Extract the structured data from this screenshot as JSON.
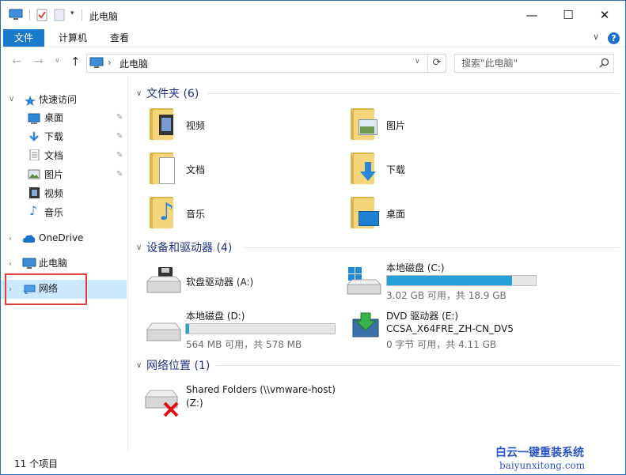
{
  "window": {
    "title": "此电脑",
    "controls": {
      "minimize": "—",
      "maximize": "☐",
      "close": "✕"
    }
  },
  "ribbon": {
    "tabs": [
      "文件",
      "计算机",
      "查看"
    ],
    "help": "?",
    "expand": "∨"
  },
  "address": {
    "path_root": "›",
    "path": "此电脑",
    "search_placeholder": "搜索\"此电脑\""
  },
  "nav": {
    "quick_access": "快速访问",
    "quick_items": [
      "桌面",
      "下载",
      "文档",
      "图片",
      "视频",
      "音乐"
    ],
    "onedrive": "OneDrive",
    "this_pc": "此电脑",
    "network": "网络"
  },
  "content": {
    "folders_header": "文件夹 (6)",
    "folders": [
      "视频",
      "图片",
      "文档",
      "下载",
      "音乐",
      "桌面"
    ],
    "devices_header": "设备和驱动器 (4)",
    "drives": [
      {
        "name": "软盘驱动器 (A:)",
        "sub": "",
        "fraction_used": null
      },
      {
        "name": "本地磁盘 (C:)",
        "sub": "3.02 GB 可用，共 18.9 GB",
        "fraction_used": 0.84
      },
      {
        "name": "本地磁盘 (D:)",
        "sub": "564 MB 可用，共 578 MB",
        "fraction_used": 0.02
      },
      {
        "name": "DVD 驱动器 (E:)",
        "label2": "CCSA_X64FRE_ZH-CN_DV5",
        "sub": "0 字节 可用，共 4.11 GB",
        "fraction_used": null
      }
    ],
    "network_header": "网络位置 (1)",
    "network_item": {
      "name": "Shared Folders (\\\\vmware-host)",
      "letter": "(Z:)"
    }
  },
  "status": {
    "count": "11 个项目"
  },
  "watermark": {
    "line1": "白云一键重装系统",
    "line2": "baiyunxitong.com"
  },
  "colors": {
    "accent": "#1979ca",
    "bar_fill": "#26a0da",
    "selection": "#cce8ff",
    "highlight_box": "#e0403a",
    "group_header": "#1e3287"
  }
}
